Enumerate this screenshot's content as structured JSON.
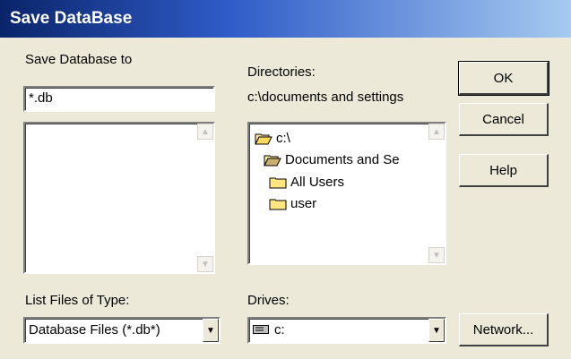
{
  "window": {
    "title": "Save DataBase"
  },
  "labels": {
    "save_to": "Save Database to",
    "directories": "Directories:",
    "current_dir": "c:\\documents and settings",
    "file_type": "List Files of Type:",
    "drives": "Drives:"
  },
  "filename_input": {
    "value": "*.db"
  },
  "file_type_select": {
    "value": "Database Files (*.db*)"
  },
  "drives_select": {
    "value": "c:"
  },
  "directory_tree": [
    {
      "label": "c:\\",
      "icon": "folder-open-icon"
    },
    {
      "label": "Documents and Se",
      "icon": "folder-open-icon"
    },
    {
      "label": "All Users",
      "icon": "folder-icon"
    },
    {
      "label": "user",
      "icon": "folder-icon"
    }
  ],
  "buttons": {
    "ok": "OK",
    "cancel": "Cancel",
    "help": "Help",
    "network": "Network..."
  },
  "colors": {
    "title_start": "#0a246a",
    "title_end": "#a6caf0",
    "dialog_bg": "#ece9d8"
  }
}
